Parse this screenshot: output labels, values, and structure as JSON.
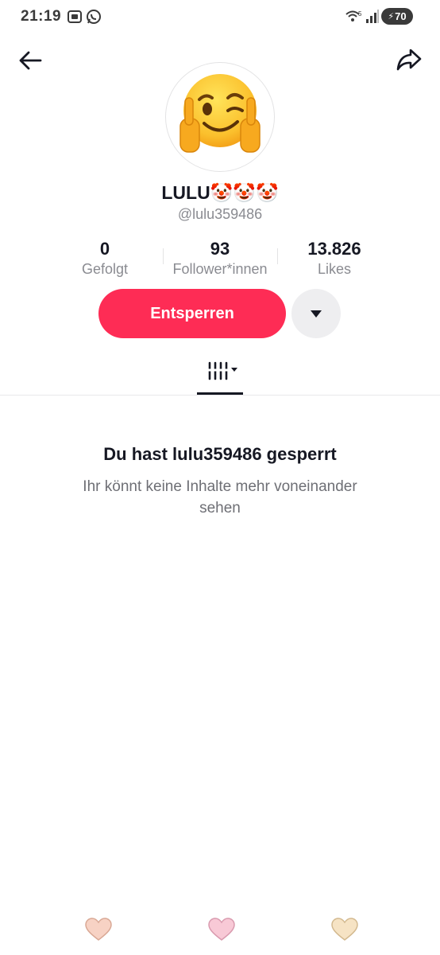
{
  "status_bar": {
    "time": "21:19",
    "battery": "70"
  },
  "profile": {
    "display_name": "LULU🤡🤡🤡",
    "username": "@lulu359486",
    "avatar_emoji": "😉🖕🖕"
  },
  "stats": [
    {
      "value": "0",
      "label": "Gefolgt"
    },
    {
      "value": "93",
      "label": "Follower*innen"
    },
    {
      "value": "13.826",
      "label": "Likes"
    }
  ],
  "actions": {
    "unblock_label": "Entsperren"
  },
  "blocked": {
    "title": "Du hast lulu359486 gesperrt",
    "message": "Ihr könnt keine Inhalte mehr voneinander sehen"
  },
  "colors": {
    "accent": "#fe2c55",
    "text": "#161823",
    "muted": "#8a8b91"
  },
  "hearts": [
    "#f7d2c4",
    "#f8c9d6",
    "#f6e3c4"
  ]
}
